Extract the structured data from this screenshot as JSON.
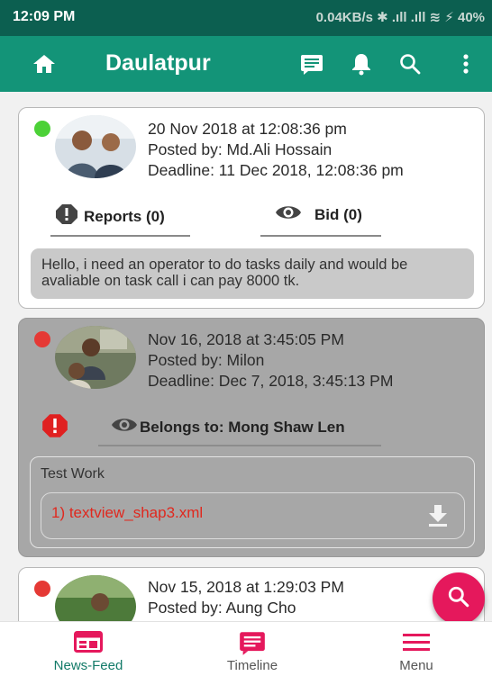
{
  "status_bar": {
    "time": "12:09 PM",
    "indicators": "0.04KB/s ✱ .ıll .ıll ≋ ⚡ 40%"
  },
  "app_bar": {
    "title": "Daulatpur",
    "icons": [
      "home-icon",
      "message-icon",
      "bell-icon",
      "search-icon",
      "more-vertical-icon"
    ],
    "color": "#139478"
  },
  "posts": [
    {
      "status_color": "#4cd137",
      "date": "20 Nov 2018 at 12:08:36 pm",
      "posted_by": "Posted by: Md.Ali Hossain",
      "deadline": "Deadline: 11 Dec 2018, 12:08:36 pm",
      "reports_label": "Reports (0)",
      "bid_label": "Bid (0)",
      "description": "Hello, i need an operator to do tasks daily and would be avaliable on task call i can pay   8000 tk."
    },
    {
      "status_color": "#e53935",
      "date": "Nov 16, 2018 at 3:45:05 PM",
      "posted_by": "Posted by: Milon",
      "deadline": "Deadline: Dec 7, 2018, 3:45:13 PM",
      "belongs_to": "Belongs to: Mong Shaw Len",
      "attachment_title": "Test Work",
      "attachment_file": "1) textview_shap3.xml"
    },
    {
      "status_color": "#e53935",
      "date": "Nov 15, 2018 at 1:29:03 PM",
      "posted_by": "Posted by: Aung Cho"
    }
  ],
  "fab": {
    "icon": "search-icon",
    "color": "#e5185c"
  },
  "bottom_nav": {
    "items": [
      {
        "label": "News-Feed",
        "icon": "newsfeed-icon",
        "active": true
      },
      {
        "label": "Timeline",
        "icon": "timeline-icon",
        "active": false
      },
      {
        "label": "Menu",
        "icon": "menu-icon",
        "active": false
      }
    ],
    "active_color": "#e5185c"
  }
}
